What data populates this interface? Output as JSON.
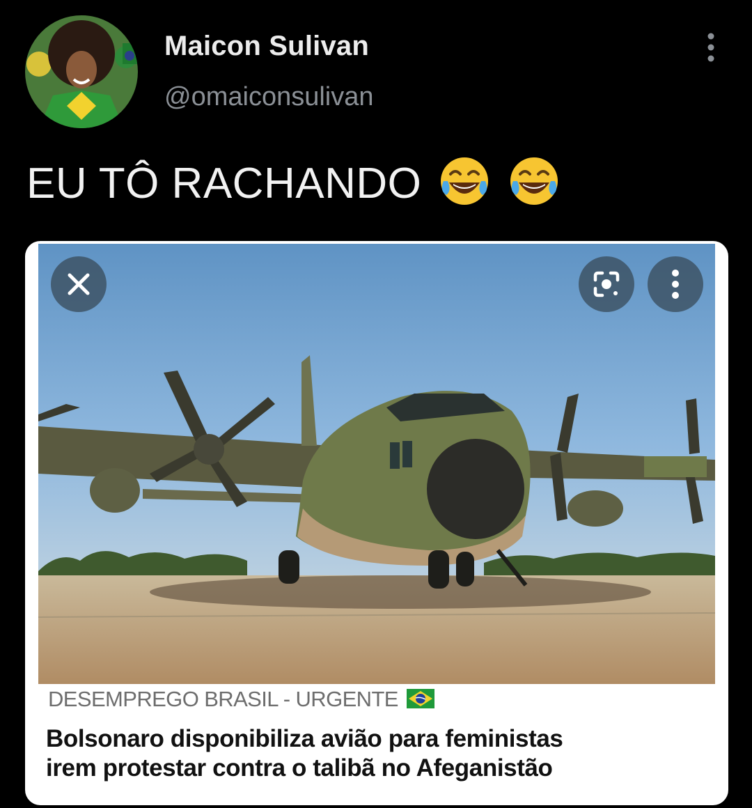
{
  "author": {
    "display_name": "Maicon Sulivan",
    "handle": "@omaiconsulivan",
    "avatar_icon": "profile-photo-avatar"
  },
  "tweet": {
    "text": "EU TÔ RACHANDO",
    "emojis": [
      "😂",
      "😂"
    ]
  },
  "media": {
    "overlay_buttons": [
      "close-icon",
      "lens-scan-icon",
      "more-vertical-icon"
    ],
    "source": "DESEMPREGO BRASIL - URGENTE",
    "source_flag": "brazil-flag",
    "headline_line1": "Bolsonaro disponibiliza avião para feministas",
    "headline_line2": "irem protestar contra o talibã no Afeganistão"
  },
  "colors": {
    "background": "#000000",
    "display_name": "#ececec",
    "handle": "#8b9096",
    "card_bg": "#ffffff",
    "source_text": "#6d6d6d",
    "headline_text": "#111111",
    "overlay_button": "#3c5062"
  }
}
